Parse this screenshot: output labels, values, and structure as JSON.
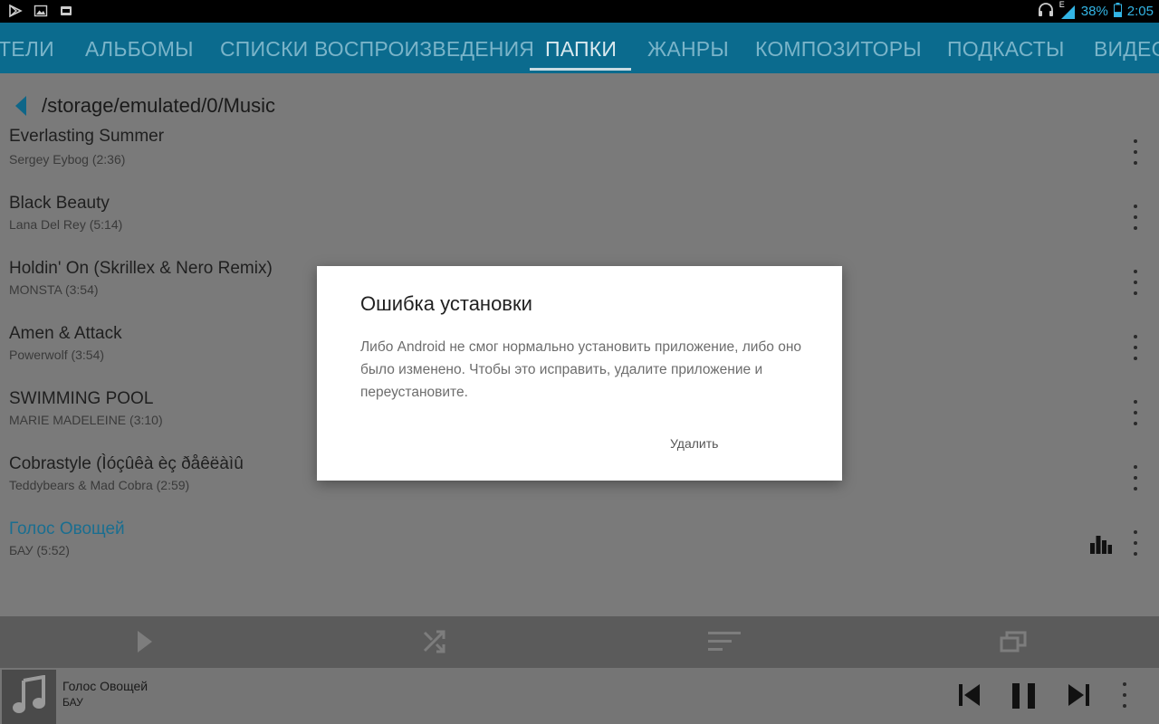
{
  "status_bar": {
    "network_type": "E",
    "battery_percent": "38%",
    "battery_level": 0.38,
    "time": "2:05",
    "icons": [
      "play-store-icon",
      "image-icon",
      "sd-card-icon",
      "headphones-icon",
      "signal-icon",
      "battery-icon"
    ]
  },
  "tabs": [
    {
      "label": "ТЕЛИ"
    },
    {
      "label": "АЛЬБОМЫ"
    },
    {
      "label": "СПИСКИ ВОСПРОИЗВЕДЕНИЯ"
    },
    {
      "label": "ПАПКИ"
    },
    {
      "label": "ЖАНРЫ"
    },
    {
      "label": "КОМПОЗИТОРЫ"
    },
    {
      "label": "ПОДКАСТЫ"
    },
    {
      "label": "ВИДЕО"
    }
  ],
  "path": "/storage/emulated/0/Music",
  "tracks": [
    {
      "title": "Everlasting Summer",
      "subtitle": "Sergey Eybog (2:36)"
    },
    {
      "title": "Black Beauty",
      "subtitle": "Lana Del Rey (5:14)"
    },
    {
      "title": "Holdin' On (Skrillex & Nero Remix)",
      "subtitle": "MONSTA (3:54)"
    },
    {
      "title": "Amen & Attack",
      "subtitle": "Powerwolf (3:54)"
    },
    {
      "title": "SWIMMING POOL",
      "subtitle": "MARIE MADELEINE (3:10)"
    },
    {
      "title": "Cobrastyle (Ìóçûêà èç ðåêëàìû",
      "subtitle": "Teddybears & Mad Cobra (2:59)"
    },
    {
      "title": "Голос Овощей",
      "subtitle": "БАУ (5:52)"
    }
  ],
  "now_playing": {
    "title": "Голос Овощей",
    "artist": "БАУ"
  },
  "dialog": {
    "title": "Ошибка установки",
    "message": "Либо Android не смог нормально установить приложение, либо оно было изменено. Чтобы это исправить, удалите приложение и переустановите.",
    "button": "Удалить"
  },
  "colors": {
    "accent": "#33b5e5",
    "tab_bar": "#0b6b8e",
    "playing_track": "#1a6e90"
  }
}
